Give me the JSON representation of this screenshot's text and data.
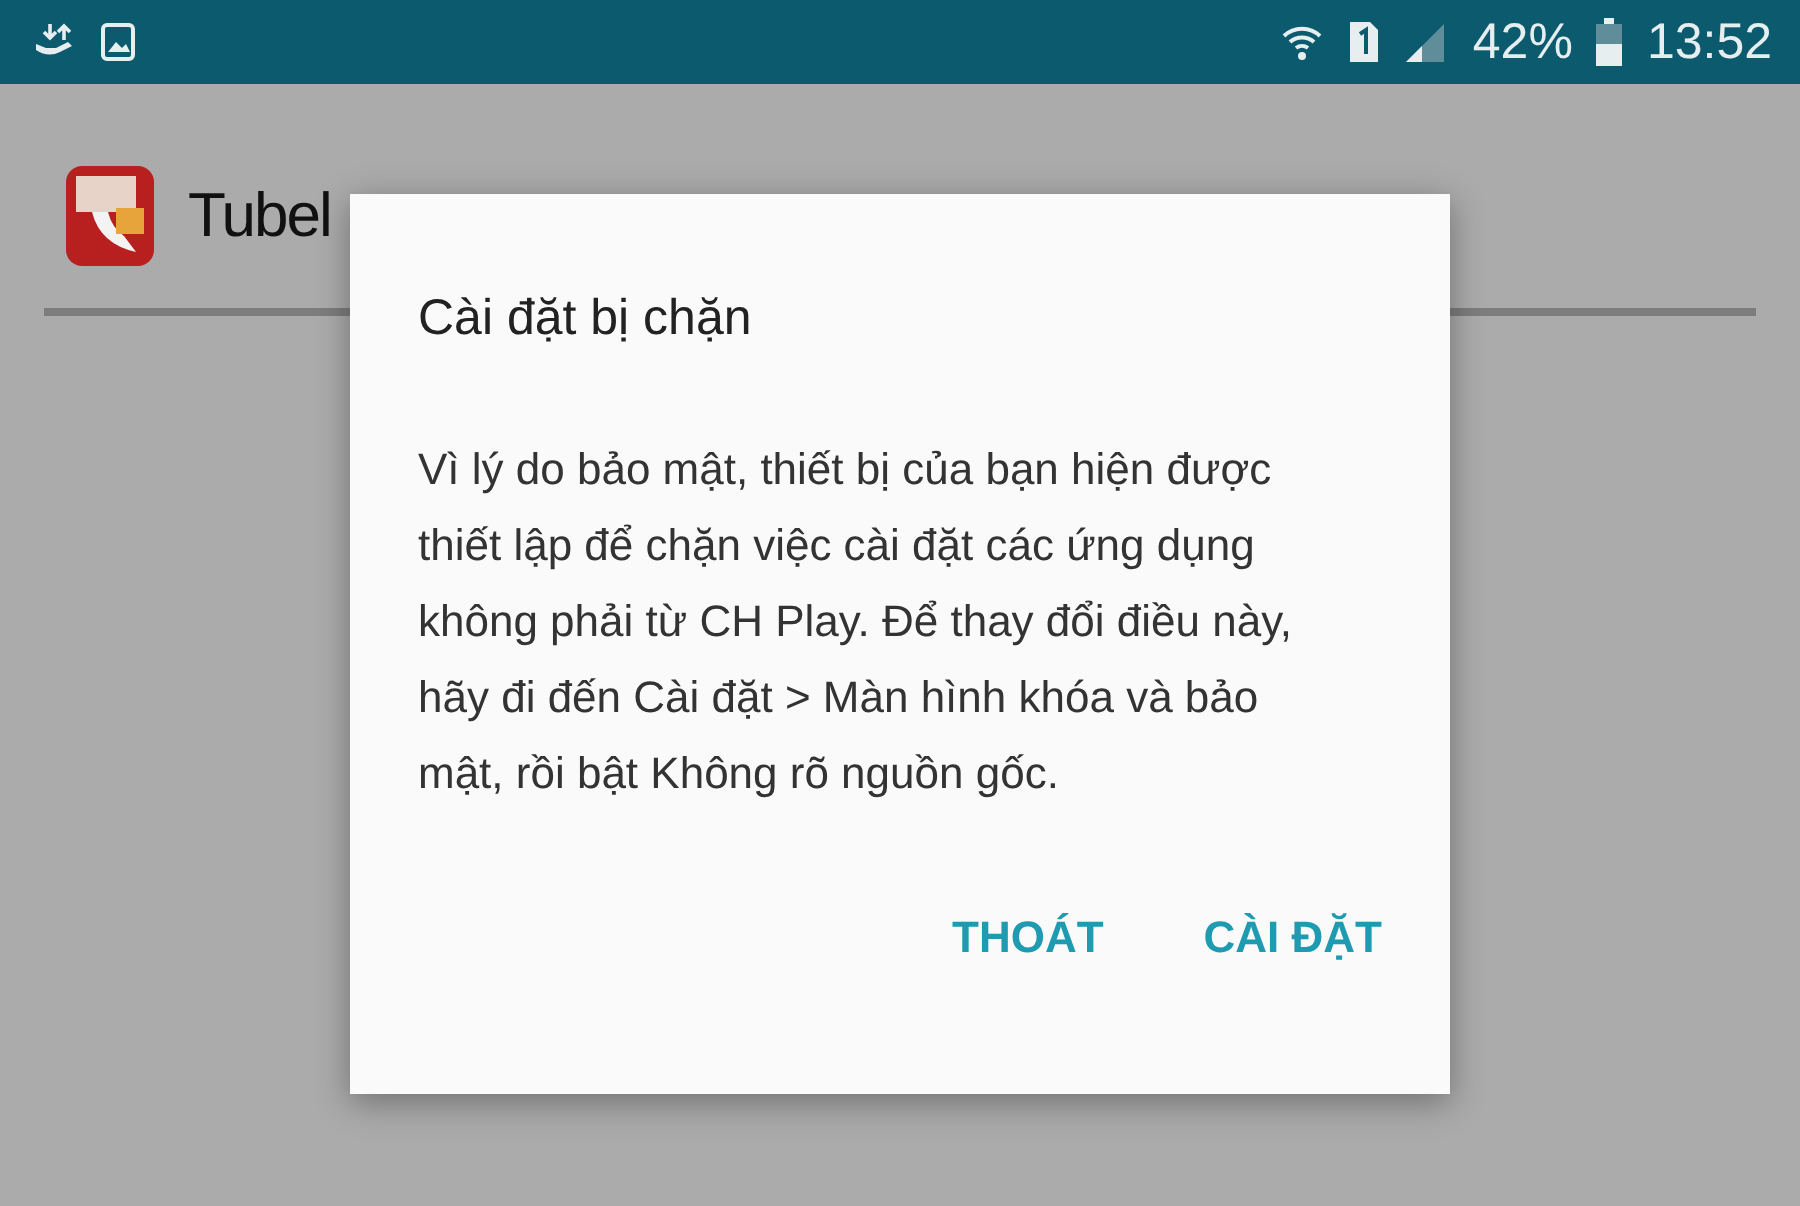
{
  "status_bar": {
    "battery": "42%",
    "time": "13:52"
  },
  "app_header": {
    "title": "Tubel"
  },
  "dialog": {
    "title": "Cài đặt bị chặn",
    "message": "Vì lý do bảo mật, thiết bị của bạn hiện được thiết lập để chặn việc cài đặt các ứng dụng không phải từ CH Play. Để thay đổi điều này, hãy đi đến Cài đặt > Màn hình khóa và bảo mật, rồi bật Không rõ nguồn gốc.",
    "buttons": [
      "THOÁT",
      "CÀI ĐẶT"
    ]
  }
}
